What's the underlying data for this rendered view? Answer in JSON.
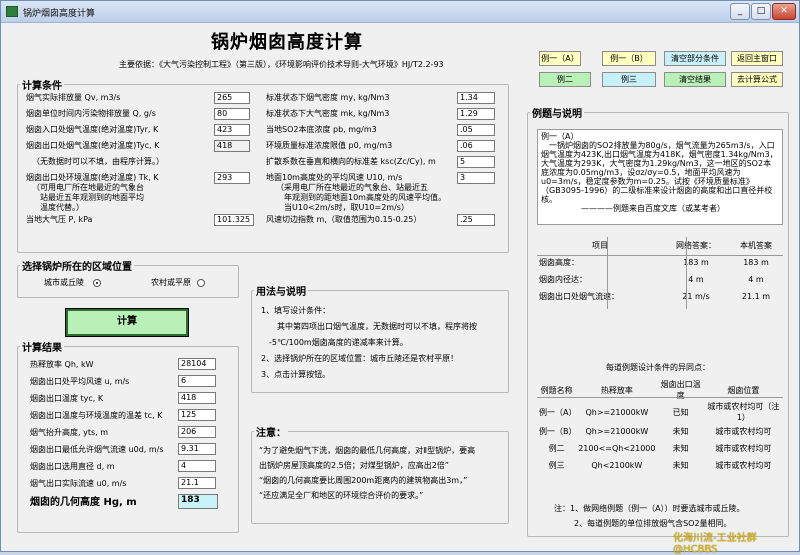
{
  "window": {
    "title": "锅炉烟囱高度计算",
    "min": "_",
    "max": "□",
    "close": "✕"
  },
  "main_title": "锅炉烟囱高度计算",
  "basis": "主要依据：《大气污染控制工程》（第三版），《环境影响评价技术导则-大气环境》HJ/T2.2-93",
  "buttons": {
    "ex1": "例一（A）",
    "ex1b": "例一（B）",
    "clear_cond": "清空部分条件",
    "back": "返回主窗口",
    "ex2": "例二",
    "ex3": "例三",
    "clear_result": "清空结果",
    "formula": "去计算公式",
    "calc": "计算"
  },
  "cond": {
    "legend": "计算条件",
    "left": [
      {
        "label": "烟气实际排放量 Qv, m3/s",
        "value": "265"
      },
      {
        "label": "烟囱单位时间内污染物排放量  Q, g/s",
        "value": "80"
      },
      {
        "label": "烟囱入口处烟气温度(绝对温度)Tyr, K",
        "value": "423"
      },
      {
        "label": "烟囱出口处烟气温度(绝对温度)Tyc, K",
        "value": "418"
      }
    ],
    "left_note1": "（无数据时可以不填，由程序计算。）",
    "left_amb_label": "烟囱出口处环境温度(绝对温度) Tk, K",
    "left_amb_note": "（可用电厂所在地最近的气象台\n　站最近五年观测到的地面平均\n　温度代替。）",
    "left_amb_value": "293",
    "pressure": {
      "label": "当地大气压 P, kPa",
      "value": "101.325"
    },
    "right": [
      {
        "label": "标准状态下烟气密度 my, kg/Nm3",
        "value": "1.34"
      },
      {
        "label": "标准状态下大气密度 mk, kg/Nm3",
        "value": "1.29"
      },
      {
        "label": "当地SO2本底浓度 pb, mg/m3",
        "value": ".05"
      },
      {
        "label": "环境质量标准浓度限值 p0, mg/m3",
        "value": ".06"
      },
      {
        "label": "扩散系数在垂直和横向的标准差 ksc(Zc/Cy), m",
        "value": "5"
      }
    ],
    "wind_label": "地面10m高度处的平均风速 U10, m/s",
    "wind_note": "（采用电厂所在地最近的气象台、站最近五\n　年观测到的距地面10m高度处的风速平均值。\n　当U10<2m/s时，取U10=2m/s）",
    "wind_value": "3",
    "exp": {
      "label": "风速切边指数 m,（取值范围为0.15-0.25）",
      "value": ".25"
    }
  },
  "region": {
    "legend": "选择锅炉所在的区域位置",
    "opt1": "城市或丘陵",
    "opt2": "农村或平原"
  },
  "results": {
    "legend": "计算结果",
    "rows": [
      {
        "label": "热释放率 Qh, kW",
        "value": "28104"
      },
      {
        "label": "烟囱出口处平均风速 u, m/s",
        "value": "6"
      },
      {
        "label": "烟囱出口温度 tyc, K",
        "value": "418"
      },
      {
        "label": "烟囱出口温度与环境温度的温差 tc, K",
        "value": "125"
      },
      {
        "label": "烟气抬升高度, yts, m",
        "value": "206"
      },
      {
        "label": "烟囱出口最低允许烟气流速 u0d, m/s",
        "value": "9.31"
      },
      {
        "label": "烟囱出口选用直径 d, m",
        "value": "4"
      },
      {
        "label": "烟气出口实际流速 u0, m/s",
        "value": "21.1"
      }
    ],
    "height_label": "烟囱的几何高度  Hg, m",
    "height_value": "183"
  },
  "usage": {
    "legend": "用法与说明",
    "lines": [
      "1、填写设计条件：",
      "　　其中第四项出口烟气温度，无数据时可以不填，程序将按",
      "-5℃/100m烟囱高度的递减率来计算。",
      "2、选择锅炉所在的区域位置：城市丘陵还是农村平原！",
      "3、点击计算按钮。"
    ]
  },
  "notice": {
    "legend": "注意：",
    "lines": [
      "“为了避免烟气下洗，烟囱的最低几何高度，对Ⅱ型锅炉，要高",
      "出锅炉房屋顶高度的2.5倍；对煤型锅炉，应高出2倍”",
      "“烟囱的几何高度要比周围200m距离内的建筑物高出3m，”",
      "“还应满足全厂和地区的环境综合评价的要求。”"
    ]
  },
  "example": {
    "legend": "例题与说明",
    "text": "例一（A）\n　一锅炉烟囱的SO2排放量为80g/s，烟气流量为265m3/s，入口烟气温度为423K,出口烟气温度为418K，烟气密度1.34kg/Nm3，大气温度为293K，大气密度为1.29kg/Nm3，这一地区的SO2本底浓度为0.05mg/m3，设σz/σy=0.5，地面平均风速为u0=3m/s，稳定度参数为m=0.25。试按《环境质量标准》（GB3095-1996）的二级标准来设计烟囱的高度和出口直径并校核。\n　　　　　————例题来自百度文库（或某考者）",
    "table_headers": [
      "项目",
      "网络答案：",
      "本机答案"
    ],
    "table_rows": [
      [
        "烟囱高度：",
        "183 m",
        "183 m"
      ],
      [
        "烟囱内径达：",
        "4 m",
        "4 m"
      ],
      [
        "烟囱出口处烟气流速：",
        "21 m/s",
        "21.1 m"
      ]
    ],
    "cond_title": "每道例题设计条件的异同点：",
    "cond_headers": [
      "例题名称",
      "热释放率",
      "烟囱出口温度",
      "烟囱位置"
    ],
    "cond_rows": [
      [
        "例一（A）",
        "Qh>=21000kW",
        "已知",
        "城市或农村均可（注1）"
      ],
      [
        "例一（B）",
        "Qh>=21000kW",
        "未知",
        "城市或农村均可"
      ],
      [
        "例二",
        "2100<=Qh<21000",
        "未知",
        "城市或农村均可"
      ],
      [
        "例三",
        "Qh<2100kW",
        "未知",
        "城市或农村均可"
      ]
    ],
    "footnote1": "注：1、做网络例题（例一（A））时要选城市或丘陵。",
    "footnote2": "2、每道例题的单位排放烟气含SO2量相同。"
  },
  "watermark": "化海川流-工业社群@HCBBS"
}
